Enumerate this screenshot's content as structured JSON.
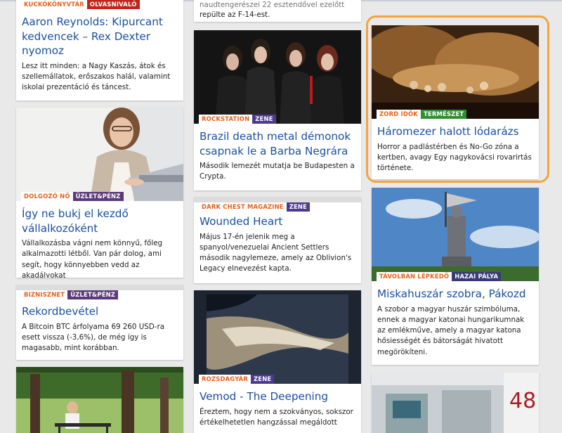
{
  "colors": {
    "source_tag": "#e8611a",
    "title": "#1a4fa0",
    "cat_olvasnivalo": "#c0251c",
    "cat_zene": "#4d3a8c",
    "cat_uzlet": "#5b3a7a",
    "cat_termeszet": "#2f8f2f",
    "cat_hazai": "#3a3a7a",
    "highlight": "#f4a340"
  },
  "column1": [
    {
      "source": "KUCKÓKÖNYVTÁR",
      "category": "OLVASNIVALÓ",
      "title": "Aaron Reynolds: Kipurcant kedvencek – Rex Dexter nyomoz",
      "excerpt": "Lesz itt minden: a Nagy Kaszás, átok és szellemállatok, erőszakos halál, valamint iskolai prezentáció és táncest."
    },
    {
      "source": "DOLGOZÓ NŐ",
      "category": "ÜZLET&PÉNZ",
      "title": "Így ne bukj el kezdő vállalkozóként",
      "excerpt": "Vállalkozásba vágni nem könnyű, főleg alkalmazotti létből. Van pár dolog, ami segít, hogy könnyebben vedd az akadályokat"
    },
    {
      "source": "BIZNISZNET",
      "category": "ÜZLET&PÉNZ",
      "title": "Rekordbevétel",
      "excerpt": "A Bitcoin BTC árfolyama 69 260 USD-ra esett vissza (-3,6%), de még így is magasabb, mint korábban."
    }
  ],
  "column2": [
    {
      "excerpt_tail": "repülte az F-14-est."
    },
    {
      "source": "ROCKSTATION",
      "category": "ZENE",
      "title": "Brazil death metal démonok csapnak le a Barba Negrára",
      "excerpt": "Második lemezét mutatja be Budapesten a Crypta."
    },
    {
      "source": "DARK CHEST MAGAZINE",
      "category": "ZENE",
      "title": "Wounded Heart",
      "excerpt": "Május 17-én jelenik meg a spanyol/venezuelai Ancient Settlers második nagylemeze, amely az Oblivion's Legacy elnevezést kapta."
    },
    {
      "source": "ROZSDAGYÁR",
      "category": "ZENE",
      "title": "Vemod - The Deepening",
      "excerpt": "Éreztem, hogy nem a szokványos, sokszor értékelhetetlen hangzással megáldott"
    }
  ],
  "column3": [
    {
      "source": "ZORD IDŐK",
      "category": "TERMÉSZET",
      "title": "Háromezer halott lódarázs",
      "excerpt": "Horror a padlástérben és No-Go zóna a kertben, avagy Egy nagykovácsi rovarirtás története."
    },
    {
      "source": "TÁVOLBAN LÉPKEDŐ",
      "category": "HAZAI PÁLYA",
      "title": "Miskahuszár szobra, Pákozd",
      "excerpt": "A szobor a magyar huszár szimbóluma, ennek a magyar katonai hungarikumnak az emlékműve, amely a magyar katona hősiességét és bátorságát hivatott megörökíteni."
    }
  ]
}
